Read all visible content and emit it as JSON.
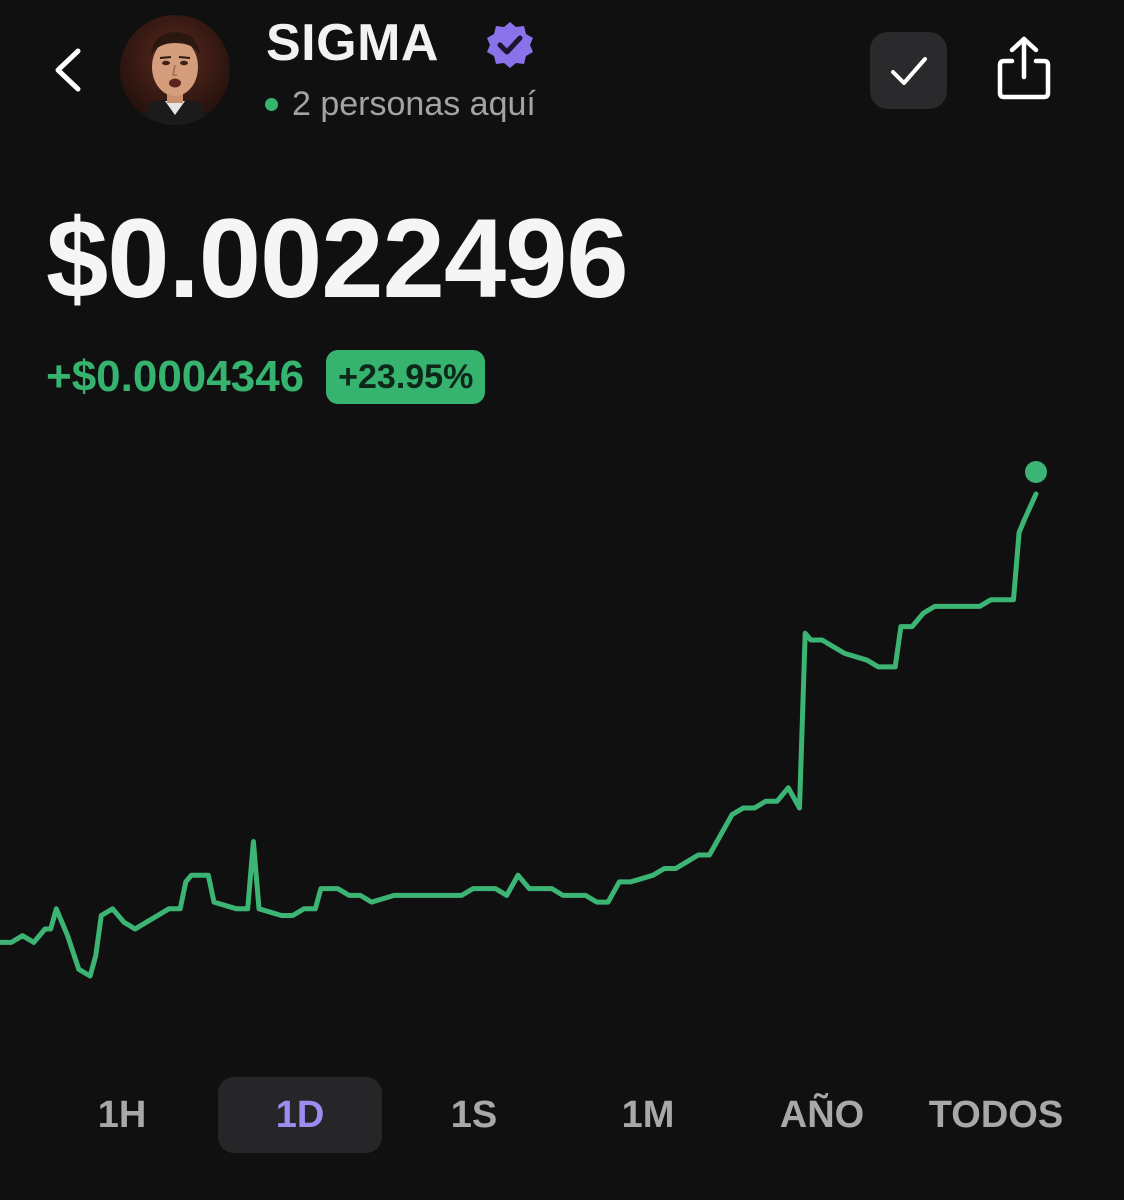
{
  "header": {
    "token_name": "SIGMA",
    "presence_text": "2 personas aquí"
  },
  "price": {
    "current": "$0.0022496",
    "change_abs": "+$0.0004346",
    "change_pct": "+23.95%"
  },
  "colors": {
    "accent_green": "#35b36f",
    "accent_purple": "#9d8cf0",
    "background": "#101010"
  },
  "chart_data": {
    "type": "line",
    "x_unit": "fraction of selected 1D range",
    "points": [
      [
        0.0,
        0.00172
      ],
      [
        0.01,
        0.00172
      ],
      [
        0.02,
        0.00173
      ],
      [
        0.03,
        0.00172
      ],
      [
        0.04,
        0.00174
      ],
      [
        0.045,
        0.00174
      ],
      [
        0.05,
        0.00177
      ],
      [
        0.06,
        0.00173
      ],
      [
        0.07,
        0.00168
      ],
      [
        0.08,
        0.00167
      ],
      [
        0.085,
        0.0017
      ],
      [
        0.09,
        0.00176
      ],
      [
        0.1,
        0.00177
      ],
      [
        0.11,
        0.00175
      ],
      [
        0.12,
        0.00174
      ],
      [
        0.13,
        0.00175
      ],
      [
        0.14,
        0.00176
      ],
      [
        0.15,
        0.00177
      ],
      [
        0.16,
        0.00177
      ],
      [
        0.165,
        0.00181
      ],
      [
        0.17,
        0.00182
      ],
      [
        0.185,
        0.00182
      ],
      [
        0.19,
        0.00178
      ],
      [
        0.21,
        0.00177
      ],
      [
        0.22,
        0.00177
      ],
      [
        0.225,
        0.00187
      ],
      [
        0.23,
        0.00177
      ],
      [
        0.25,
        0.00176
      ],
      [
        0.26,
        0.00176
      ],
      [
        0.27,
        0.00177
      ],
      [
        0.28,
        0.00177
      ],
      [
        0.285,
        0.0018
      ],
      [
        0.3,
        0.0018
      ],
      [
        0.31,
        0.00179
      ],
      [
        0.32,
        0.00179
      ],
      [
        0.33,
        0.00178
      ],
      [
        0.35,
        0.00179
      ],
      [
        0.39,
        0.00179
      ],
      [
        0.41,
        0.00179
      ],
      [
        0.42,
        0.0018
      ],
      [
        0.44,
        0.0018
      ],
      [
        0.45,
        0.00179
      ],
      [
        0.46,
        0.00182
      ],
      [
        0.47,
        0.0018
      ],
      [
        0.49,
        0.0018
      ],
      [
        0.5,
        0.00179
      ],
      [
        0.52,
        0.00179
      ],
      [
        0.53,
        0.00178
      ],
      [
        0.54,
        0.00178
      ],
      [
        0.55,
        0.00181
      ],
      [
        0.56,
        0.00181
      ],
      [
        0.58,
        0.00182
      ],
      [
        0.59,
        0.00183
      ],
      [
        0.6,
        0.00183
      ],
      [
        0.61,
        0.00184
      ],
      [
        0.62,
        0.00185
      ],
      [
        0.63,
        0.00185
      ],
      [
        0.64,
        0.00188
      ],
      [
        0.65,
        0.00191
      ],
      [
        0.66,
        0.00192
      ],
      [
        0.67,
        0.00192
      ],
      [
        0.68,
        0.00193
      ],
      [
        0.69,
        0.00193
      ],
      [
        0.7,
        0.00195
      ],
      [
        0.71,
        0.00192
      ],
      [
        0.715,
        0.00218
      ],
      [
        0.72,
        0.00217
      ],
      [
        0.73,
        0.00217
      ],
      [
        0.75,
        0.00215
      ],
      [
        0.77,
        0.00214
      ],
      [
        0.78,
        0.00213
      ],
      [
        0.795,
        0.00213
      ],
      [
        0.8,
        0.00219
      ],
      [
        0.81,
        0.00219
      ],
      [
        0.82,
        0.00221
      ],
      [
        0.83,
        0.00222
      ],
      [
        0.84,
        0.00222
      ],
      [
        0.87,
        0.00222
      ],
      [
        0.88,
        0.00223
      ],
      [
        0.9,
        0.00223
      ],
      [
        0.905,
        0.00233
      ],
      [
        0.91,
        0.00235
      ],
      [
        0.92,
        0.00242
      ]
    ],
    "last_point_marker": true,
    "xlabel": "",
    "ylabel": ""
  },
  "range_tabs": [
    {
      "label": "1H",
      "active": false
    },
    {
      "label": "1D",
      "active": true
    },
    {
      "label": "1S",
      "active": false
    },
    {
      "label": "1M",
      "active": false
    },
    {
      "label": "AÑO",
      "active": false
    },
    {
      "label": "TODOS",
      "active": false
    }
  ]
}
